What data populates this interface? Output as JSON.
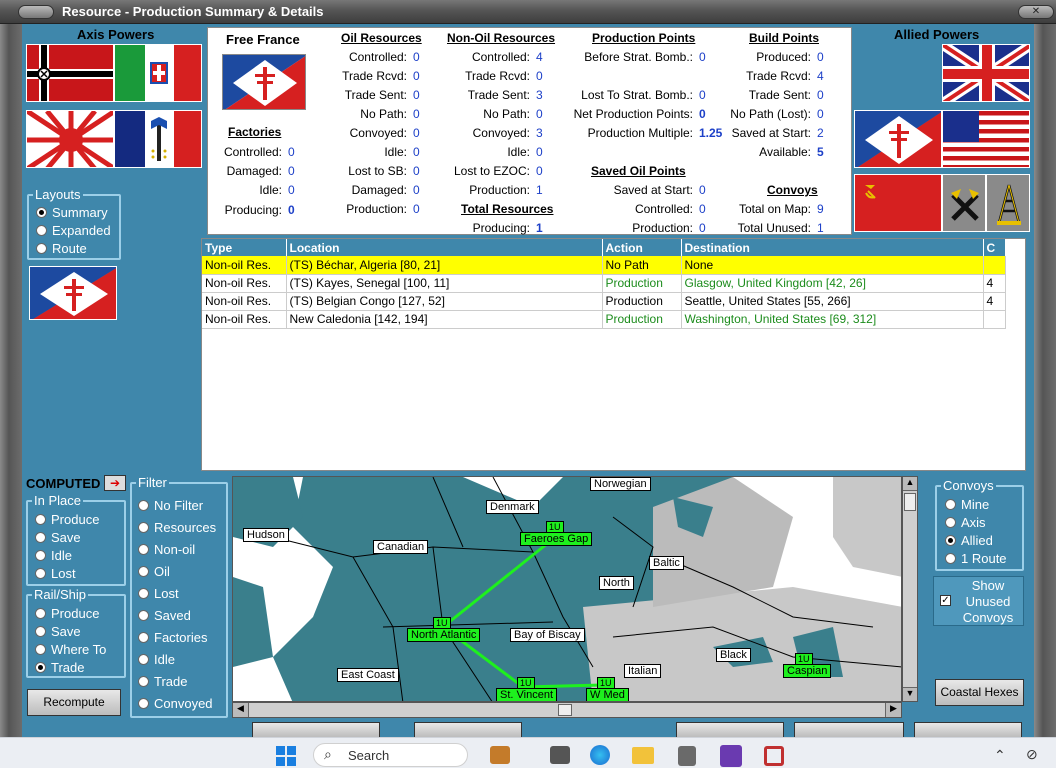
{
  "window": {
    "title": "Resource - Production Summary & Details"
  },
  "axis": {
    "title": "Axis Powers"
  },
  "allied": {
    "title": "Allied Powers"
  },
  "country": {
    "name": "Free France"
  },
  "factories": {
    "title": "Factories",
    "rows": [
      {
        "label": "Controlled:",
        "value": "0"
      },
      {
        "label": "Damaged:",
        "value": "0"
      },
      {
        "label": "Idle:",
        "value": "0"
      },
      {
        "label": "Producing:",
        "value": "0"
      }
    ]
  },
  "oil": {
    "title": "Oil Resources",
    "rows": [
      {
        "label": "Controlled:",
        "value": "0"
      },
      {
        "label": "Trade Rcvd:",
        "value": "0"
      },
      {
        "label": "Trade Sent:",
        "value": "0"
      },
      {
        "label": "No Path:",
        "value": "0"
      },
      {
        "label": "Convoyed:",
        "value": "0"
      },
      {
        "label": "Idle:",
        "value": "0"
      },
      {
        "label": "Lost to SB:",
        "value": "0"
      },
      {
        "label": "Damaged:",
        "value": "0"
      },
      {
        "label": "Production:",
        "value": "0"
      }
    ]
  },
  "nonoil": {
    "title": "Non-Oil Resources",
    "rows": [
      {
        "label": "Controlled:",
        "value": "4"
      },
      {
        "label": "Trade Rcvd:",
        "value": "0"
      },
      {
        "label": "Trade Sent:",
        "value": "3"
      },
      {
        "label": "No Path:",
        "value": "0"
      },
      {
        "label": "Convoyed:",
        "value": "3"
      },
      {
        "label": "Idle:",
        "value": "0"
      },
      {
        "label": "Lost to EZOC:",
        "value": "0"
      },
      {
        "label": "Production:",
        "value": "1"
      }
    ]
  },
  "total": {
    "title": "Total Resources",
    "label": "Producing:",
    "value": "1"
  },
  "pp": {
    "title": "Production Points",
    "rows": [
      {
        "label": "Before Strat. Bomb.:",
        "value": "0"
      },
      {
        "label": "Lost To Strat. Bomb.:",
        "value": "0"
      },
      {
        "label": "Net Production Points:",
        "value": "0"
      },
      {
        "label": "Production Multiple:",
        "value": "1.25"
      }
    ]
  },
  "saved_oil": {
    "title": "Saved Oil Points",
    "rows": [
      {
        "label": "Saved at Start:",
        "value": "0"
      },
      {
        "label": "Controlled:",
        "value": "0"
      },
      {
        "label": "Production:",
        "value": "0"
      }
    ]
  },
  "bp": {
    "title": "Build Points",
    "rows": [
      {
        "label": "Produced:",
        "value": "0"
      },
      {
        "label": "Trade Rcvd:",
        "value": "4"
      },
      {
        "label": "Trade Sent:",
        "value": "0"
      },
      {
        "label": "No Path (Lost):",
        "value": "0"
      },
      {
        "label": "Saved at Start:",
        "value": "2"
      },
      {
        "label": "Available:",
        "value": "5"
      }
    ]
  },
  "convoys": {
    "title": "Convoys",
    "rows": [
      {
        "label": "Total on Map:",
        "value": "9"
      },
      {
        "label": "Total Unused:",
        "value": "1"
      }
    ]
  },
  "layouts": {
    "title": "Layouts",
    "options": [
      "Summary",
      "Expanded",
      "Route"
    ],
    "selected": 0
  },
  "table": {
    "headers": [
      "Type",
      "Location",
      "Action",
      "Destination",
      "C"
    ],
    "rows": [
      {
        "type": "Non-oil Res.",
        "location": "(TS) Béchar, Algeria [80, 21]",
        "action": "No Path",
        "destination": "None",
        "c": ""
      },
      {
        "type": "Non-oil Res.",
        "location": "(TS) Kayes, Senegal [100, 11]",
        "action": "Production",
        "destination": "Glasgow, United Kingdom [42, 26]",
        "c": "4"
      },
      {
        "type": "Non-oil Res.",
        "location": "(TS) Belgian Congo [127, 52]",
        "action": "Production",
        "destination": "Seattle, United States [55, 266]",
        "c": "4"
      },
      {
        "type": "Non-oil Res.",
        "location": "New Caledonia [142, 194]",
        "action": "Production",
        "destination": "Washington, United States [69, 312]",
        "c": ""
      }
    ]
  },
  "computed": {
    "label": "COMPUTED"
  },
  "inplace": {
    "title": "In Place",
    "options": [
      "Produce",
      "Save",
      "Idle",
      "Lost"
    ]
  },
  "railship": {
    "title": "Rail/Ship",
    "options": [
      "Produce",
      "Save",
      "Where To",
      "Trade"
    ],
    "selected": 3
  },
  "filter": {
    "title": "Filter",
    "options": [
      "No Filter",
      "Resources",
      "Non-oil",
      "Oil",
      "Lost",
      "Saved",
      "Factories",
      "Idle",
      "Trade",
      "Convoyed"
    ]
  },
  "convoy_filter": {
    "title": "Convoys",
    "options": [
      "Mine",
      "Axis",
      "Allied",
      "1 Route"
    ],
    "selected": 2
  },
  "show_unused": {
    "label": "Show Unused Convoys",
    "checked": true
  },
  "buttons": {
    "recompute": "Recompute",
    "coastal": "Coastal Hexes"
  },
  "map": {
    "labels": [
      "Norwegian",
      "Denmark",
      "Baltic",
      "North",
      "Hudson",
      "Canadian",
      "Bay of Biscay",
      "Italian",
      "Black",
      "East Coast"
    ],
    "convoy_zones": [
      {
        "name": "Faeroes Gap",
        "count": "1U"
      },
      {
        "name": "North Atlantic",
        "count": "1U"
      },
      {
        "name": "St. Vincent",
        "count": "1U"
      },
      {
        "name": "W Med",
        "count": "1U"
      },
      {
        "name": "Caspian",
        "count": "1U"
      }
    ]
  },
  "taskbar": {
    "search": "Search"
  },
  "colors": {
    "bg": "#3f87ab",
    "highlight": "#ffff00",
    "value_blue": "#1d40c8",
    "convoy_green": "#1ef01e"
  }
}
